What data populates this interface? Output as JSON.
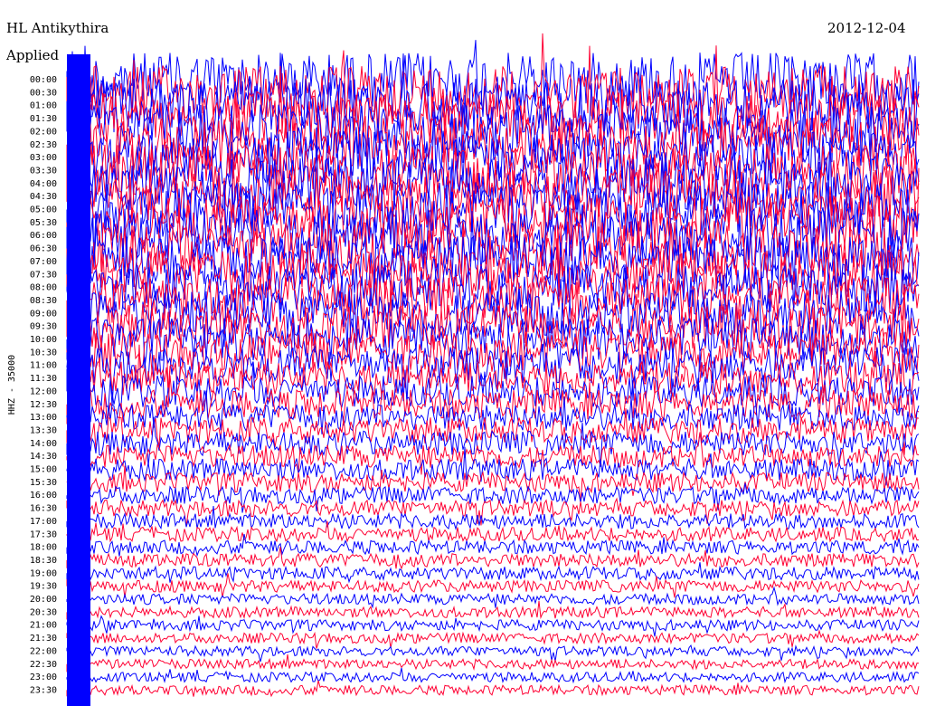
{
  "header": {
    "station": "HL Antikythira",
    "date": "2012-12-04",
    "filter_note": "Applied"
  },
  "chart_data": {
    "type": "line",
    "ylabel": "HHZ - 35000",
    "time_labels": [
      "00:00",
      "00:30",
      "01:00",
      "01:30",
      "02:00",
      "02:30",
      "03:00",
      "03:30",
      "04:00",
      "04:30",
      "05:00",
      "05:30",
      "06:00",
      "06:30",
      "07:00",
      "07:30",
      "08:00",
      "08:30",
      "09:00",
      "09:30",
      "10:00",
      "10:30",
      "11:00",
      "11:30",
      "12:00",
      "12:30",
      "13:00",
      "13:30",
      "14:00",
      "14:30",
      "15:00",
      "15:30",
      "16:00",
      "16:30",
      "17:00",
      "17:30",
      "18:00",
      "18:30",
      "19:00",
      "19:30",
      "20:00",
      "20:30",
      "21:00",
      "21:30",
      "22:00",
      "22:30",
      "23:00",
      "23:30"
    ],
    "trace_amplitude_relative": [
      1.0,
      1.0,
      1.0,
      1.0,
      1.0,
      1.0,
      1.0,
      1.0,
      1.0,
      1.0,
      1.0,
      1.0,
      1.0,
      1.0,
      0.95,
      0.92,
      0.9,
      0.88,
      0.85,
      0.82,
      0.78,
      0.72,
      0.68,
      0.62,
      0.58,
      0.55,
      0.5,
      0.48,
      0.45,
      0.42,
      0.4,
      0.36,
      0.32,
      0.3,
      0.28,
      0.26,
      0.25,
      0.25,
      0.24,
      0.22,
      0.2,
      0.2,
      0.2,
      0.19,
      0.18,
      0.18,
      0.18,
      0.18
    ],
    "series_colors": [
      "#0000ff",
      "#ff0033"
    ],
    "grid": false
  }
}
